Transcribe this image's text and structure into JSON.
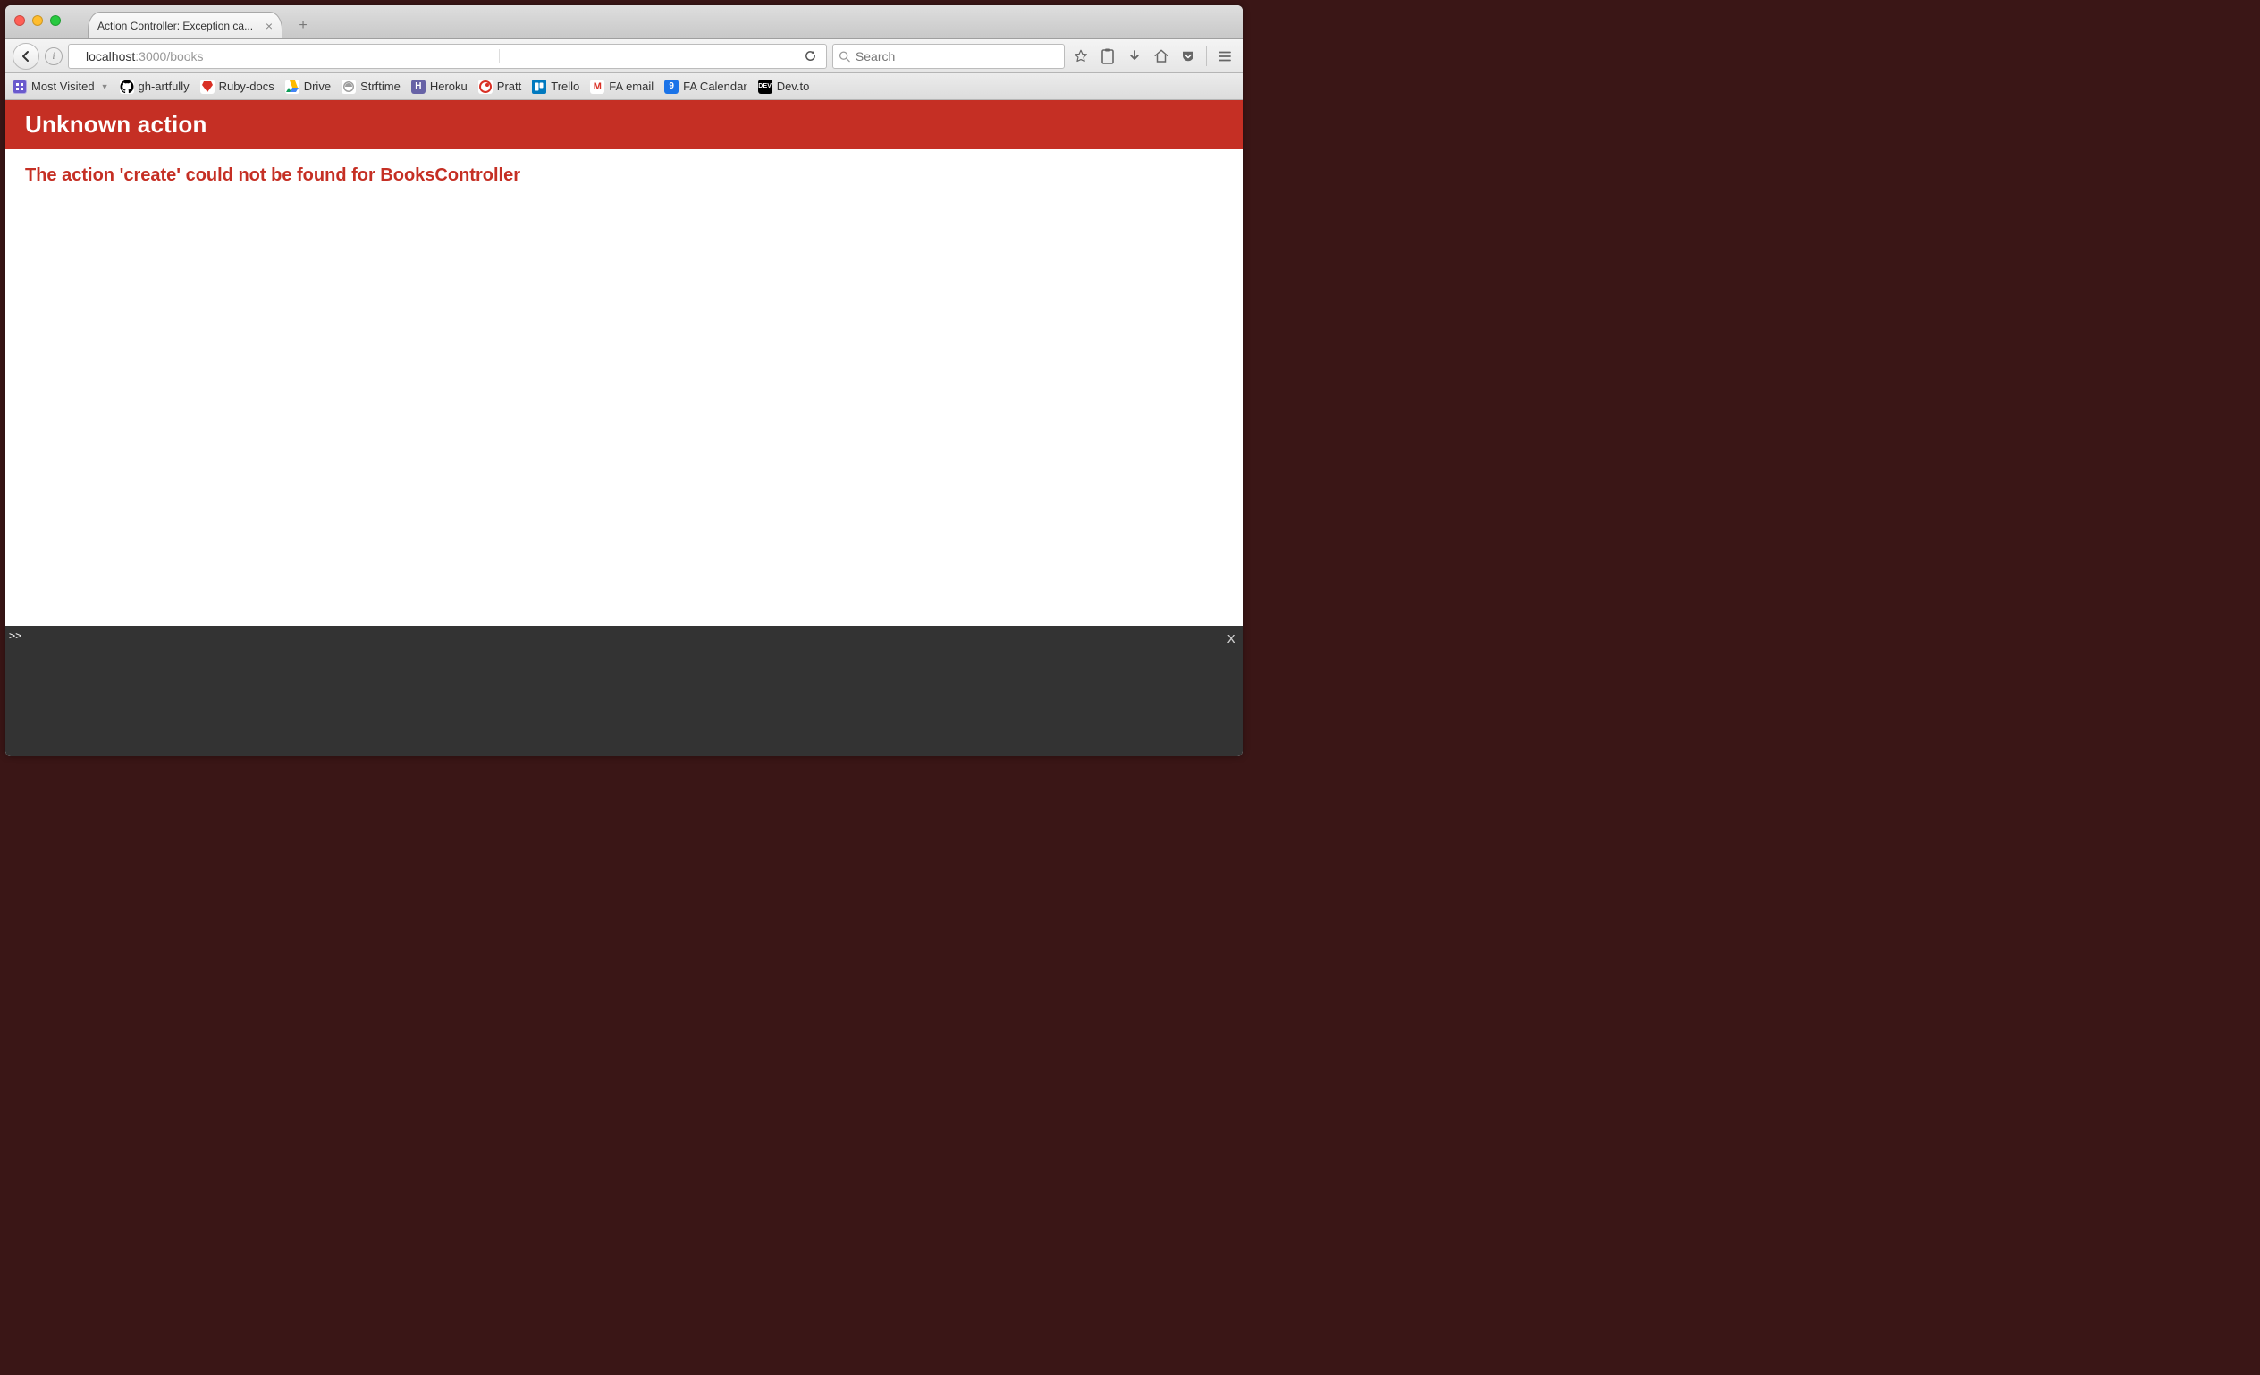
{
  "window": {
    "tab_title": "Action Controller: Exception ca..."
  },
  "toolbar": {
    "url_host": "localhost",
    "url_port": ":3000",
    "url_path": "/books",
    "search_placeholder": "Search",
    "info_glyph": "i"
  },
  "bookmarks": [
    {
      "label": "Most Visited",
      "icon_bg": "#6a5acd",
      "icon_txt": "",
      "dropdown": true,
      "name": "most-visited"
    },
    {
      "label": "gh-artfully",
      "icon_bg": "#000000",
      "icon_txt": "",
      "name": "gh-artfully"
    },
    {
      "label": "Ruby-docs",
      "icon_bg": "#d93025",
      "icon_txt": "",
      "name": "ruby-docs"
    },
    {
      "label": "Drive",
      "icon_bg": "#ffffff",
      "icon_txt": "",
      "name": "drive"
    },
    {
      "label": "Strftime",
      "icon_bg": "#9e9e9e",
      "icon_txt": "",
      "name": "strftime"
    },
    {
      "label": "Heroku",
      "icon_bg": "#6762a6",
      "icon_txt": "H",
      "name": "heroku"
    },
    {
      "label": "Pratt",
      "icon_bg": "#ffffff",
      "icon_txt": "",
      "name": "pratt"
    },
    {
      "label": "Trello",
      "icon_bg": "#0079bf",
      "icon_txt": "",
      "name": "trello"
    },
    {
      "label": "FA email",
      "icon_bg": "#ffffff",
      "icon_txt": "M",
      "name": "fa-email"
    },
    {
      "label": "FA Calendar",
      "icon_bg": "#1a73e8",
      "icon_txt": "9",
      "name": "fa-calendar"
    },
    {
      "label": "Dev.to",
      "icon_bg": "#000000",
      "icon_txt": "DEV",
      "name": "dev-to"
    }
  ],
  "error": {
    "title": "Unknown action",
    "message": "The action 'create' could not be found for BooksController"
  },
  "console": {
    "prompt": ">>",
    "close": "x"
  }
}
